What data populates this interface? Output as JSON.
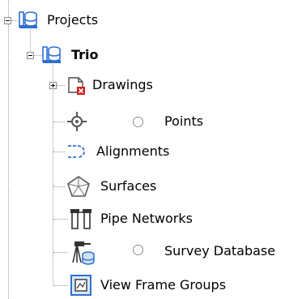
{
  "tree": {
    "root": {
      "label": "Projects",
      "icon": "project-database-icon",
      "expanded": true
    },
    "project": {
      "label": "Trio",
      "icon": "project-database-icon",
      "expanded": true
    },
    "items": [
      {
        "label": "Drawings",
        "icon": "drawings-icon",
        "expandable": true,
        "radio": false
      },
      {
        "label": "Points",
        "icon": "points-icon",
        "expandable": false,
        "radio": true
      },
      {
        "label": "Alignments",
        "icon": "alignments-icon",
        "expandable": false,
        "radio": false
      },
      {
        "label": "Surfaces",
        "icon": "surfaces-icon",
        "expandable": false,
        "radio": false
      },
      {
        "label": "Pipe Networks",
        "icon": "pipe-networks-icon",
        "expandable": false,
        "radio": false
      },
      {
        "label": "Survey Database",
        "icon": "survey-database-icon",
        "expandable": false,
        "radio": true
      },
      {
        "label": "View Frame Groups",
        "icon": "view-frame-groups-icon",
        "expandable": false,
        "radio": false
      }
    ]
  },
  "colors": {
    "db_blue": "#2f6fd0",
    "tree_line": "#9a9a9a",
    "error_red": "#d42020"
  }
}
